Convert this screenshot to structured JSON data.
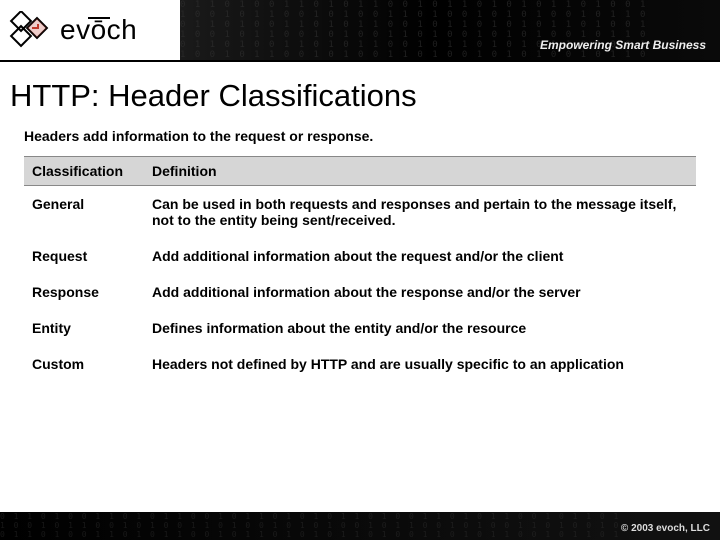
{
  "brand": {
    "name": "evōch",
    "tagline": "Empowering Smart Business"
  },
  "slide": {
    "title": "HTTP: Header Classifications",
    "subtitle": "Headers add information to the request or response."
  },
  "table": {
    "headers": {
      "col1": "Classification",
      "col2": "Definition"
    },
    "rows": [
      {
        "classification": "General",
        "definition": "Can be used in both requests and responses and pertain to the message itself, not to the entity being sent/received."
      },
      {
        "classification": "Request",
        "definition": "Add additional information about the request and/or the client"
      },
      {
        "classification": "Response",
        "definition": "Add additional information about the response and/or the server"
      },
      {
        "classification": "Entity",
        "definition": "Defines information about the entity and/or the resource"
      },
      {
        "classification": "Custom",
        "definition": "Headers not defined by HTTP and are usually specific to an application"
      }
    ]
  },
  "footer": {
    "copyright": "© 2003  evoch, LLC"
  }
}
